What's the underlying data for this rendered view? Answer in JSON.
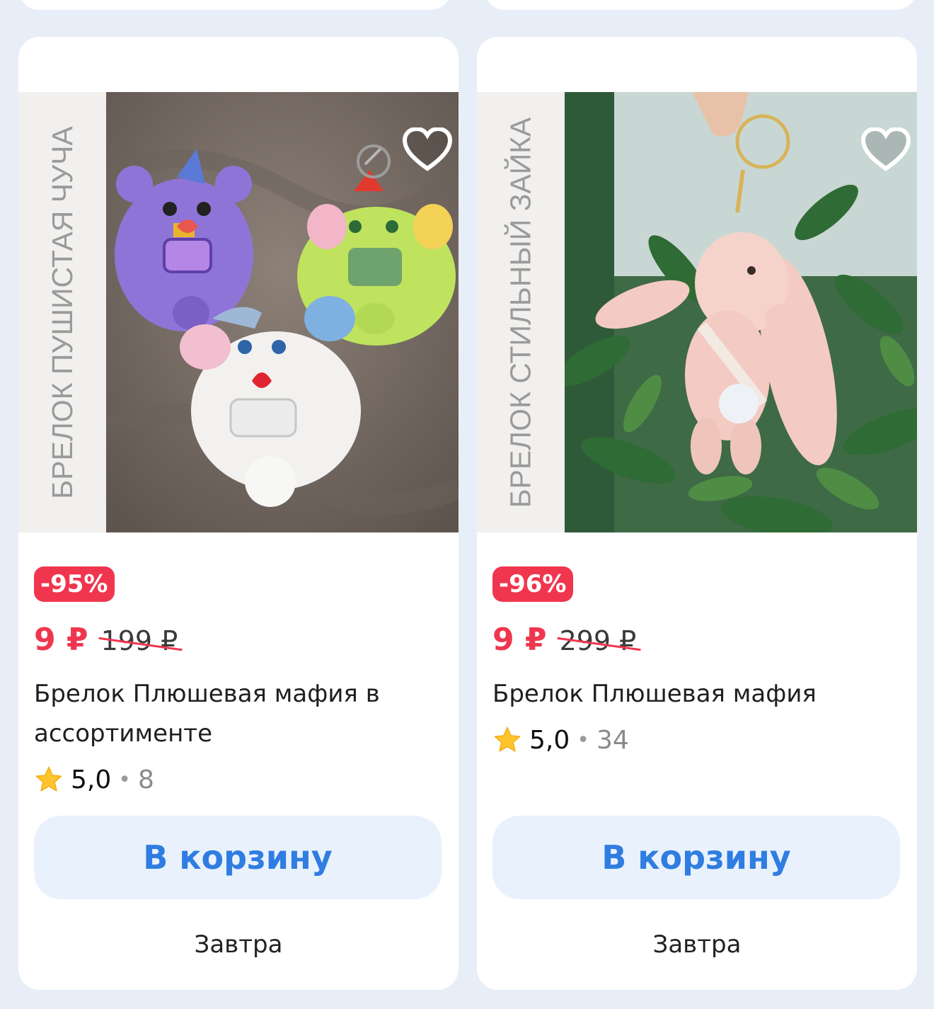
{
  "products": [
    {
      "side_caption": "БРЕЛОК ПУШИСТАЯ ЧУЧА",
      "discount": "-95%",
      "price": "9 ₽",
      "old_price": "199 ₽",
      "title": "Брелок Плюшевая мафия в ассортименте",
      "rating": "5,0",
      "reviews": "8",
      "button": "В корзину",
      "delivery": "Завтра",
      "image": "three-plush-keychains-on-brown-fabric"
    },
    {
      "side_caption": "БРЕЛОК СТИЛЬНЫЙ ЗАЙКА",
      "discount": "-96%",
      "price": "9 ₽",
      "old_price": "299 ₽",
      "title": "Брелок Плюшевая мафия",
      "rating": "5,0",
      "reviews": "34",
      "button": "В корзину",
      "delivery": "Завтра",
      "image": "pink-bunny-keychain-held-over-plants"
    }
  ],
  "icons": {
    "favorite": "heart-outline-icon",
    "rating": "star-icon"
  },
  "colors": {
    "discount": "#f0364f",
    "button_text": "#2f7de1",
    "button_bg": "#e9f1fd",
    "background": "#e8eef8"
  }
}
